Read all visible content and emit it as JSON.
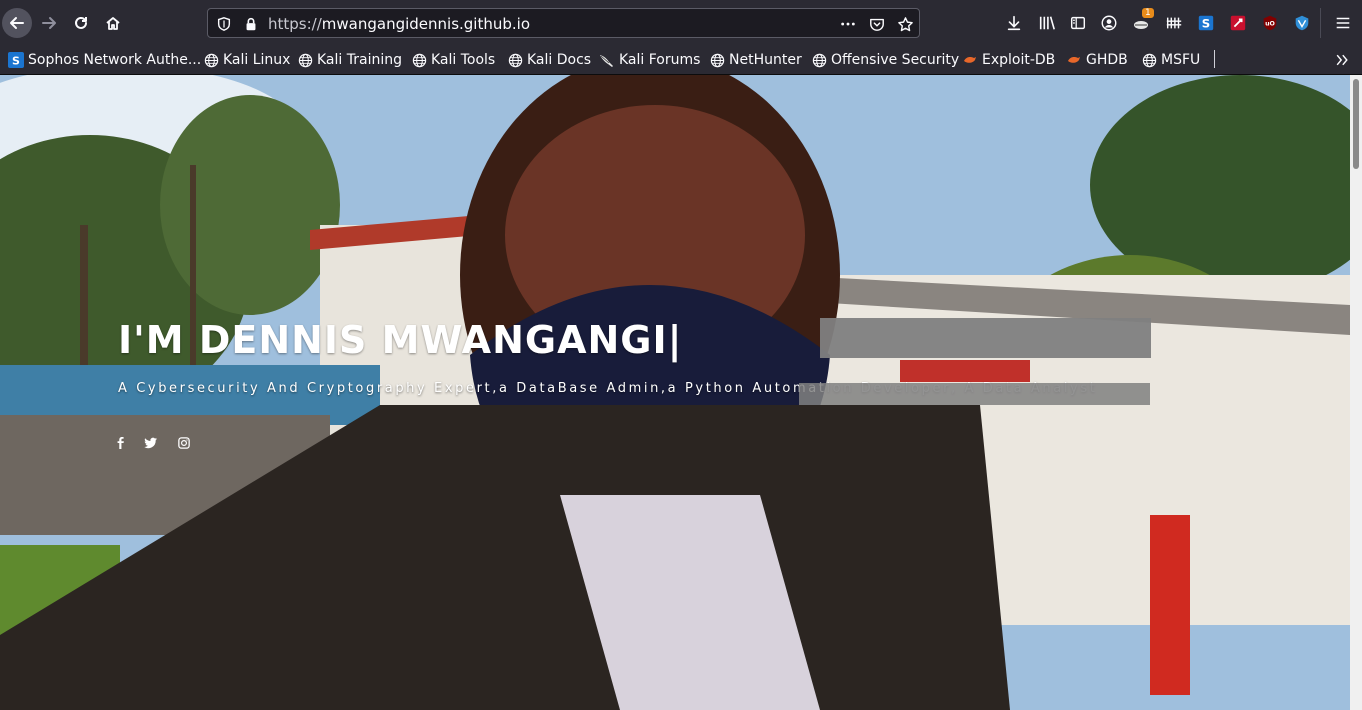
{
  "browser": {
    "url_scheme": "https://",
    "url_host": "mwangangidennis.github.io",
    "downloads_badge": "1",
    "colors": {
      "chrome": "#2b2a33",
      "urlbar": "#1c1b22",
      "text": "#fbfbfe"
    }
  },
  "bookmarks": [
    {
      "label": "Sophos Network Authe...",
      "icon": "sophos-icon"
    },
    {
      "label": "Kali Linux",
      "icon": "globe-icon"
    },
    {
      "label": "Kali Training",
      "icon": "globe-icon"
    },
    {
      "label": "Kali Tools",
      "icon": "globe-icon"
    },
    {
      "label": "Kali Docs",
      "icon": "globe-icon"
    },
    {
      "label": "Kali Forums",
      "icon": "kali-dragon-icon"
    },
    {
      "label": "NetHunter",
      "icon": "globe-icon"
    },
    {
      "label": "Offensive Security",
      "icon": "globe-icon"
    },
    {
      "label": "Exploit-DB",
      "icon": "exploitdb-icon"
    },
    {
      "label": "GHDB",
      "icon": "exploitdb-icon"
    },
    {
      "label": "MSFU",
      "icon": "globe-icon"
    }
  ],
  "hero": {
    "title": "I'M DENNIS MWANGANGI|",
    "subtitle": "A Cybersecurity And Cryptography Expert,a DataBase Admin,a Python Automation Developer, A Data Analyst",
    "social": [
      "facebook-icon",
      "twitter-icon",
      "instagram-icon"
    ]
  }
}
